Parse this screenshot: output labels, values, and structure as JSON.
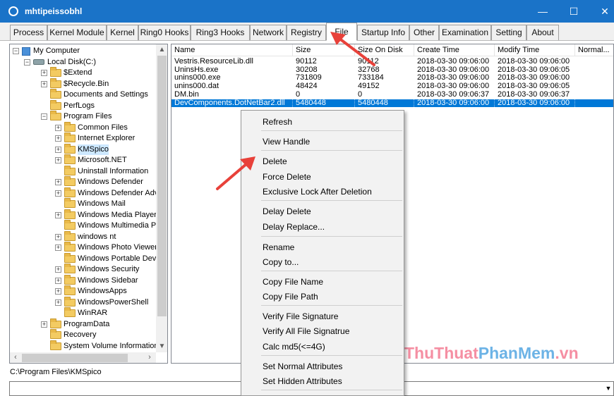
{
  "window": {
    "title": "mhtipeissobhl",
    "minimize": "—",
    "maximize": "☐",
    "close": "✕"
  },
  "tabs": [
    "Process",
    "Kernel Module",
    "Kernel",
    "Ring0 Hooks",
    "Ring3 Hooks",
    "Network",
    "Registry",
    "File",
    "Startup Info",
    "Other",
    "Examination",
    "Setting",
    "About"
  ],
  "active_tab": "File",
  "tree": {
    "items": [
      {
        "label": "My Computer",
        "icon": "computer-icon",
        "expander": "−"
      },
      {
        "label": "Local Disk(C:)",
        "icon": "drive-icon",
        "expander": "−"
      },
      {
        "label": "$Extend",
        "icon": "folder-icon",
        "expander": "+"
      },
      {
        "label": "$Recycle.Bin",
        "icon": "folder-icon",
        "expander": "+"
      },
      {
        "label": "Documents and Settings",
        "icon": "folder-icon",
        "expander": ""
      },
      {
        "label": "PerfLogs",
        "icon": "folder-icon",
        "expander": ""
      },
      {
        "label": "Program Files",
        "icon": "folder-icon",
        "expander": "−"
      },
      {
        "label": "Common Files",
        "icon": "folder-icon",
        "expander": "+"
      },
      {
        "label": "Internet Explorer",
        "icon": "folder-icon",
        "expander": "+"
      },
      {
        "label": "KMSpico",
        "icon": "folder-icon",
        "expander": "+"
      },
      {
        "label": "Microsoft.NET",
        "icon": "folder-icon",
        "expander": "+"
      },
      {
        "label": "Uninstall Information",
        "icon": "folder-icon",
        "expander": ""
      },
      {
        "label": "Windows Defender",
        "icon": "folder-icon",
        "expander": "+"
      },
      {
        "label": "Windows Defender Adv",
        "icon": "folder-icon",
        "expander": "+"
      },
      {
        "label": "Windows Mail",
        "icon": "folder-icon",
        "expander": ""
      },
      {
        "label": "Windows Media Player",
        "icon": "folder-icon",
        "expander": "+"
      },
      {
        "label": "Windows Multimedia Pla",
        "icon": "folder-icon",
        "expander": ""
      },
      {
        "label": "windows nt",
        "icon": "folder-icon",
        "expander": "+"
      },
      {
        "label": "Windows Photo Viewer",
        "icon": "folder-icon",
        "expander": "+"
      },
      {
        "label": "Windows Portable Devic",
        "icon": "folder-icon",
        "expander": ""
      },
      {
        "label": "Windows Security",
        "icon": "folder-icon",
        "expander": "+"
      },
      {
        "label": "Windows Sidebar",
        "icon": "folder-icon",
        "expander": "+"
      },
      {
        "label": "WindowsApps",
        "icon": "folder-icon",
        "expander": "+"
      },
      {
        "label": "WindowsPowerShell",
        "icon": "folder-icon",
        "expander": "+"
      },
      {
        "label": "WinRAR",
        "icon": "folder-icon",
        "expander": ""
      },
      {
        "label": "ProgramData",
        "icon": "folder-icon",
        "expander": "+"
      },
      {
        "label": "Recovery",
        "icon": "folder-icon",
        "expander": ""
      },
      {
        "label": "System Volume Information",
        "icon": "folder-icon",
        "expander": ""
      }
    ],
    "selected": "KMSpico"
  },
  "list": {
    "columns": [
      "Name",
      "Size",
      "Size On Disk",
      "Create Time",
      "Modify Time",
      "Normal..."
    ],
    "rows": [
      [
        "Vestris.ResourceLib.dll",
        "90112",
        "90112",
        "2018-03-30 09:06:00",
        "2018-03-30 09:06:00",
        ""
      ],
      [
        "UninsHs.exe",
        "30208",
        "32768",
        "2018-03-30 09:06:00",
        "2018-03-30 09:06:05",
        ""
      ],
      [
        "unins000.exe",
        "731809",
        "733184",
        "2018-03-30 09:06:00",
        "2018-03-30 09:06:00",
        ""
      ],
      [
        "unins000.dat",
        "48424",
        "49152",
        "2018-03-30 09:06:00",
        "2018-03-30 09:06:05",
        ""
      ],
      [
        "DM.bin",
        "0",
        "0",
        "2018-03-30 09:06:37",
        "2018-03-30 09:06:37",
        ""
      ],
      [
        "DevComponents.DotNetBar2.dll",
        "5480448",
        "5480448",
        "2018-03-30 09:06:00",
        "2018-03-30 09:06:00",
        ""
      ]
    ],
    "selected_row": 5
  },
  "path": "C:\\Program Files\\KMSpico",
  "context_menu": {
    "groups": [
      [
        "Refresh"
      ],
      [
        "View Handle"
      ],
      [
        "Delete",
        "Force Delete",
        "Exclusive Lock After Deletion"
      ],
      [
        "Delay Delete",
        "Delay Replace..."
      ],
      [
        "Rename",
        "Copy to..."
      ],
      [
        "Copy File Name",
        "Copy File Path"
      ],
      [
        "Verify File Signature",
        "Verify All File Signatrue",
        "Calc md5(<=4G)"
      ],
      [
        "Set Normal Attributes",
        "Set Hidden Attributes"
      ]
    ]
  },
  "watermark": {
    "part1": "ThuThuat",
    "part2": "PhanMem",
    "part3": ".vn"
  },
  "colors": {
    "titlebar": "#1a73c8",
    "selection": "#0078d7",
    "arrow": "#e8413a"
  }
}
